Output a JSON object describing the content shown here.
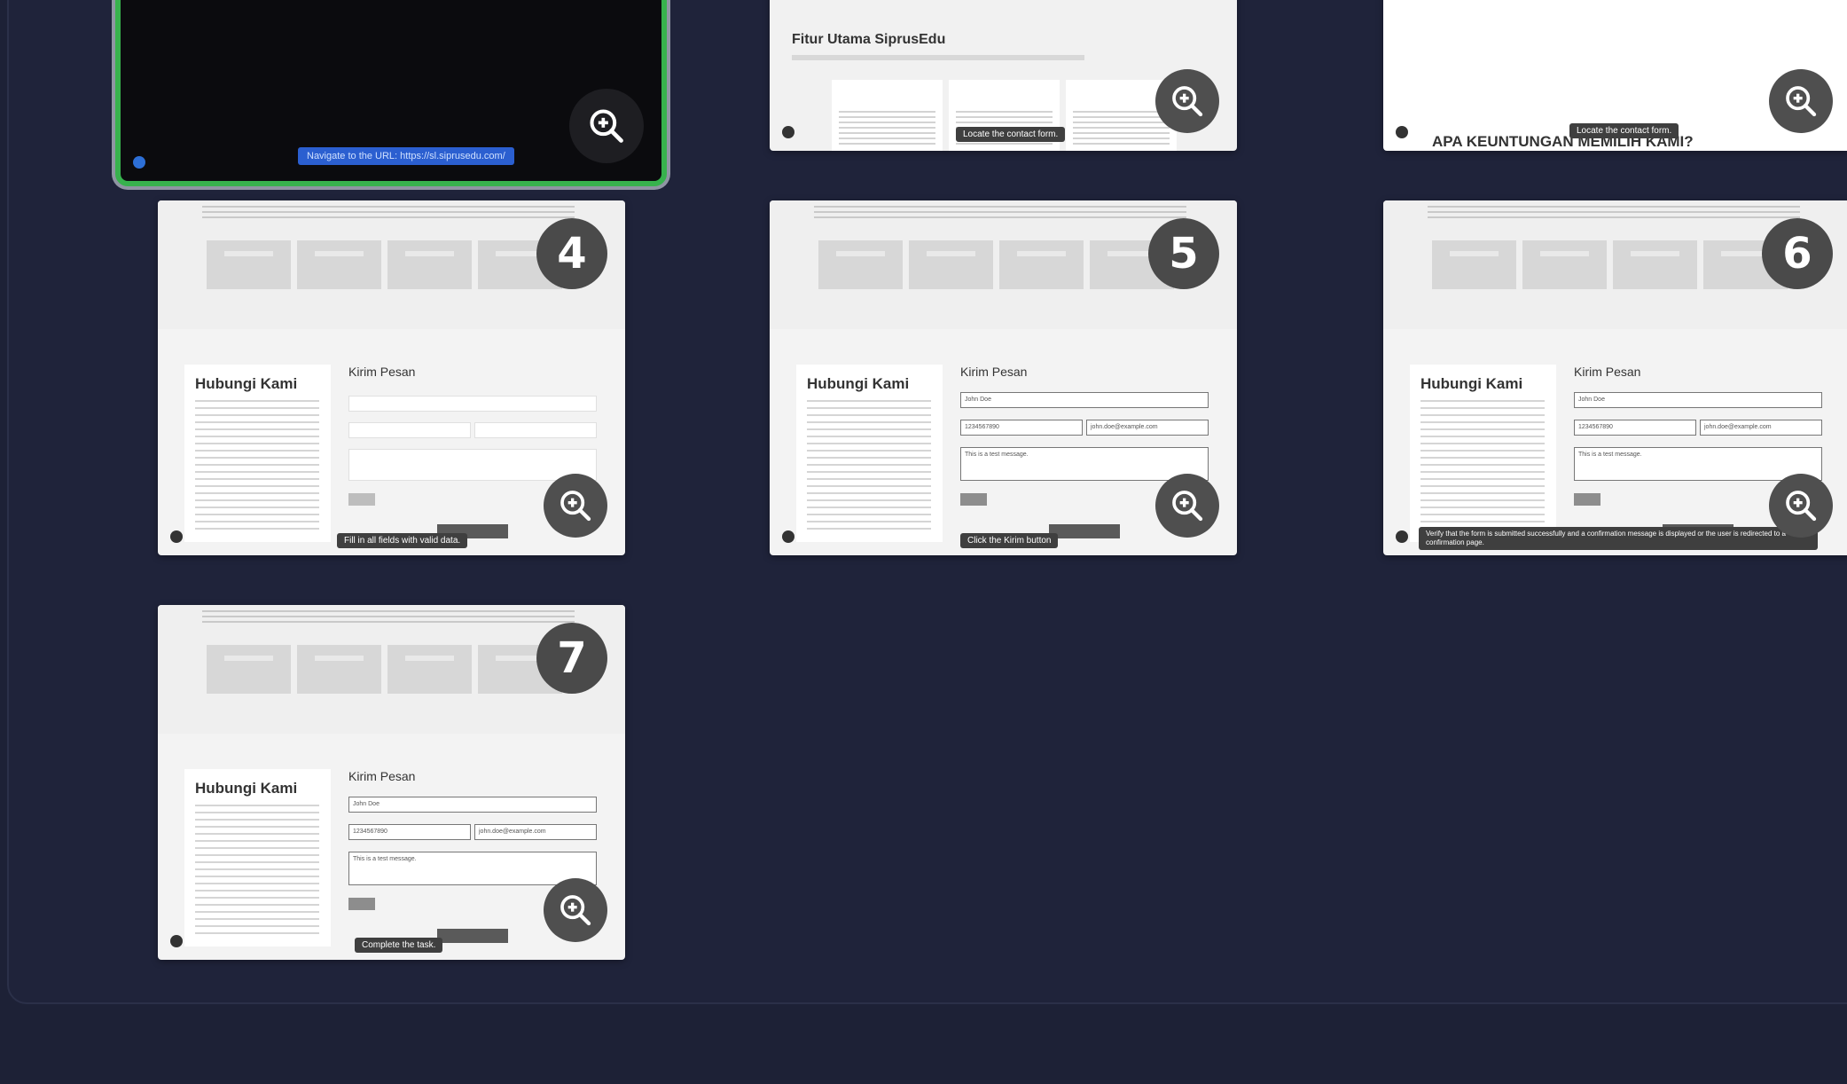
{
  "cards": {
    "c1": {
      "url_action": "Navigate to the URL: https://sl.siprusedu.com/"
    },
    "c2": {
      "heading": "Fitur Utama SiprusEdu",
      "pill": "Locate the contact form."
    },
    "c3": {
      "heading": "APA KEUNTUNGAN MEMILIH KAMI?",
      "pill": "Locate the contact form."
    },
    "c4": {
      "badge": "4",
      "pill": "Fill in all fields with valid data.",
      "hubungi": "Hubungi Kami",
      "kirim": "Kirim Pesan"
    },
    "c5": {
      "badge": "5",
      "pill": "Click the Kirim button",
      "hubungi": "Hubungi Kami",
      "kirim": "Kirim Pesan",
      "name_val": "John Doe",
      "phone_val": "1234567890",
      "email_val": "john.doe@example.com",
      "msg_val": "This is a test message."
    },
    "c6": {
      "badge": "6",
      "pill": "Verify that the form is submitted successfully and a confirmation message is displayed or the user is redirected to a confirmation page.",
      "hubungi": "Hubungi Kami",
      "kirim": "Kirim Pesan",
      "name_val": "John Doe",
      "phone_val": "1234567890",
      "email_val": "john.doe@example.com",
      "msg_val": "This is a test message."
    },
    "c7": {
      "badge": "7",
      "pill": "Complete the task.",
      "hubungi": "Hubungi Kami",
      "kirim": "Kirim Pesan",
      "name_val": "John Doe",
      "phone_val": "1234567890",
      "email_val": "john.doe@example.com",
      "msg_val": "This is a test message."
    }
  },
  "icons": {
    "zoom": "zoom-in-icon"
  }
}
